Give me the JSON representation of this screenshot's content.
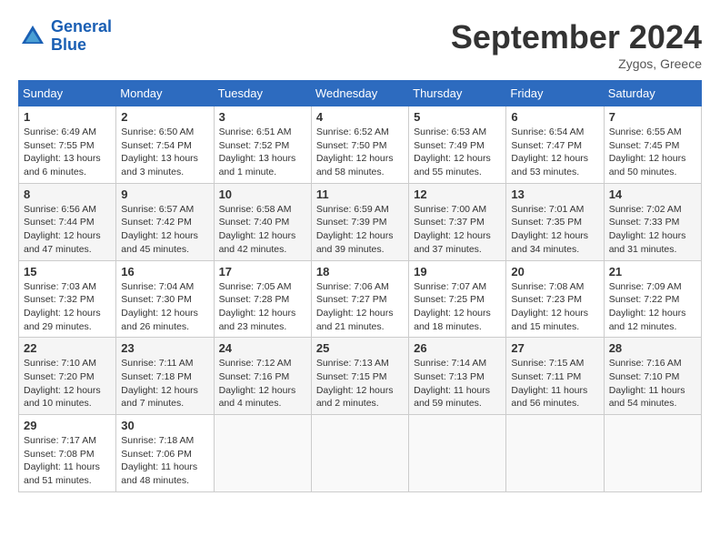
{
  "header": {
    "logo_line1": "General",
    "logo_line2": "Blue",
    "month_title": "September 2024",
    "location": "Zygos, Greece"
  },
  "weekdays": [
    "Sunday",
    "Monday",
    "Tuesday",
    "Wednesday",
    "Thursday",
    "Friday",
    "Saturday"
  ],
  "weeks": [
    [
      {
        "day": "1",
        "sunrise": "Sunrise: 6:49 AM",
        "sunset": "Sunset: 7:55 PM",
        "daylight": "Daylight: 13 hours and 6 minutes."
      },
      {
        "day": "2",
        "sunrise": "Sunrise: 6:50 AM",
        "sunset": "Sunset: 7:54 PM",
        "daylight": "Daylight: 13 hours and 3 minutes."
      },
      {
        "day": "3",
        "sunrise": "Sunrise: 6:51 AM",
        "sunset": "Sunset: 7:52 PM",
        "daylight": "Daylight: 13 hours and 1 minute."
      },
      {
        "day": "4",
        "sunrise": "Sunrise: 6:52 AM",
        "sunset": "Sunset: 7:50 PM",
        "daylight": "Daylight: 12 hours and 58 minutes."
      },
      {
        "day": "5",
        "sunrise": "Sunrise: 6:53 AM",
        "sunset": "Sunset: 7:49 PM",
        "daylight": "Daylight: 12 hours and 55 minutes."
      },
      {
        "day": "6",
        "sunrise": "Sunrise: 6:54 AM",
        "sunset": "Sunset: 7:47 PM",
        "daylight": "Daylight: 12 hours and 53 minutes."
      },
      {
        "day": "7",
        "sunrise": "Sunrise: 6:55 AM",
        "sunset": "Sunset: 7:45 PM",
        "daylight": "Daylight: 12 hours and 50 minutes."
      }
    ],
    [
      {
        "day": "8",
        "sunrise": "Sunrise: 6:56 AM",
        "sunset": "Sunset: 7:44 PM",
        "daylight": "Daylight: 12 hours and 47 minutes."
      },
      {
        "day": "9",
        "sunrise": "Sunrise: 6:57 AM",
        "sunset": "Sunset: 7:42 PM",
        "daylight": "Daylight: 12 hours and 45 minutes."
      },
      {
        "day": "10",
        "sunrise": "Sunrise: 6:58 AM",
        "sunset": "Sunset: 7:40 PM",
        "daylight": "Daylight: 12 hours and 42 minutes."
      },
      {
        "day": "11",
        "sunrise": "Sunrise: 6:59 AM",
        "sunset": "Sunset: 7:39 PM",
        "daylight": "Daylight: 12 hours and 39 minutes."
      },
      {
        "day": "12",
        "sunrise": "Sunrise: 7:00 AM",
        "sunset": "Sunset: 7:37 PM",
        "daylight": "Daylight: 12 hours and 37 minutes."
      },
      {
        "day": "13",
        "sunrise": "Sunrise: 7:01 AM",
        "sunset": "Sunset: 7:35 PM",
        "daylight": "Daylight: 12 hours and 34 minutes."
      },
      {
        "day": "14",
        "sunrise": "Sunrise: 7:02 AM",
        "sunset": "Sunset: 7:33 PM",
        "daylight": "Daylight: 12 hours and 31 minutes."
      }
    ],
    [
      {
        "day": "15",
        "sunrise": "Sunrise: 7:03 AM",
        "sunset": "Sunset: 7:32 PM",
        "daylight": "Daylight: 12 hours and 29 minutes."
      },
      {
        "day": "16",
        "sunrise": "Sunrise: 7:04 AM",
        "sunset": "Sunset: 7:30 PM",
        "daylight": "Daylight: 12 hours and 26 minutes."
      },
      {
        "day": "17",
        "sunrise": "Sunrise: 7:05 AM",
        "sunset": "Sunset: 7:28 PM",
        "daylight": "Daylight: 12 hours and 23 minutes."
      },
      {
        "day": "18",
        "sunrise": "Sunrise: 7:06 AM",
        "sunset": "Sunset: 7:27 PM",
        "daylight": "Daylight: 12 hours and 21 minutes."
      },
      {
        "day": "19",
        "sunrise": "Sunrise: 7:07 AM",
        "sunset": "Sunset: 7:25 PM",
        "daylight": "Daylight: 12 hours and 18 minutes."
      },
      {
        "day": "20",
        "sunrise": "Sunrise: 7:08 AM",
        "sunset": "Sunset: 7:23 PM",
        "daylight": "Daylight: 12 hours and 15 minutes."
      },
      {
        "day": "21",
        "sunrise": "Sunrise: 7:09 AM",
        "sunset": "Sunset: 7:22 PM",
        "daylight": "Daylight: 12 hours and 12 minutes."
      }
    ],
    [
      {
        "day": "22",
        "sunrise": "Sunrise: 7:10 AM",
        "sunset": "Sunset: 7:20 PM",
        "daylight": "Daylight: 12 hours and 10 minutes."
      },
      {
        "day": "23",
        "sunrise": "Sunrise: 7:11 AM",
        "sunset": "Sunset: 7:18 PM",
        "daylight": "Daylight: 12 hours and 7 minutes."
      },
      {
        "day": "24",
        "sunrise": "Sunrise: 7:12 AM",
        "sunset": "Sunset: 7:16 PM",
        "daylight": "Daylight: 12 hours and 4 minutes."
      },
      {
        "day": "25",
        "sunrise": "Sunrise: 7:13 AM",
        "sunset": "Sunset: 7:15 PM",
        "daylight": "Daylight: 12 hours and 2 minutes."
      },
      {
        "day": "26",
        "sunrise": "Sunrise: 7:14 AM",
        "sunset": "Sunset: 7:13 PM",
        "daylight": "Daylight: 11 hours and 59 minutes."
      },
      {
        "day": "27",
        "sunrise": "Sunrise: 7:15 AM",
        "sunset": "Sunset: 7:11 PM",
        "daylight": "Daylight: 11 hours and 56 minutes."
      },
      {
        "day": "28",
        "sunrise": "Sunrise: 7:16 AM",
        "sunset": "Sunset: 7:10 PM",
        "daylight": "Daylight: 11 hours and 54 minutes."
      }
    ],
    [
      {
        "day": "29",
        "sunrise": "Sunrise: 7:17 AM",
        "sunset": "Sunset: 7:08 PM",
        "daylight": "Daylight: 11 hours and 51 minutes."
      },
      {
        "day": "30",
        "sunrise": "Sunrise: 7:18 AM",
        "sunset": "Sunset: 7:06 PM",
        "daylight": "Daylight: 11 hours and 48 minutes."
      },
      null,
      null,
      null,
      null,
      null
    ]
  ]
}
